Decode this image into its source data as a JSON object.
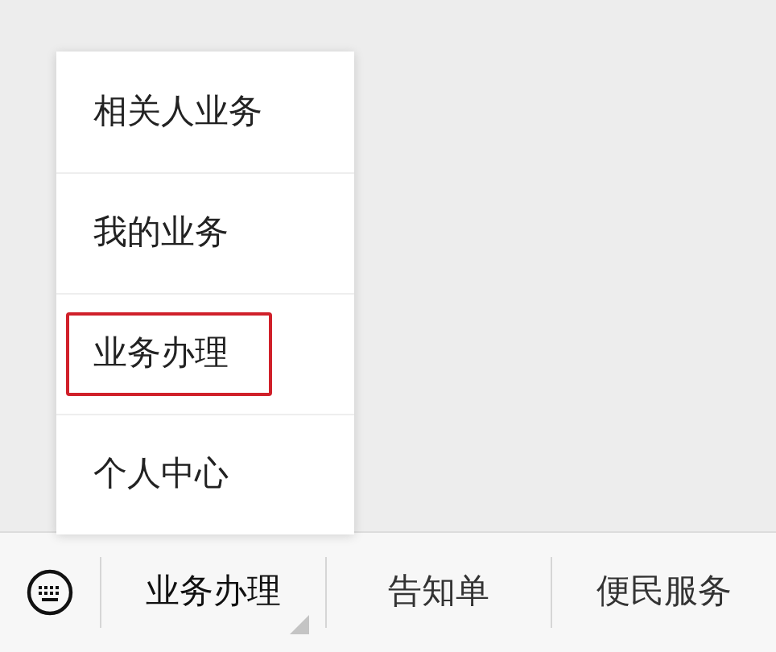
{
  "submenu": {
    "items": [
      {
        "label": "相关人业务",
        "highlighted": false
      },
      {
        "label": "我的业务",
        "highlighted": false
      },
      {
        "label": "业务办理",
        "highlighted": true
      },
      {
        "label": "个人中心",
        "highlighted": false
      }
    ]
  },
  "menu_bar": {
    "items": [
      {
        "label": "业务办理",
        "has_submenu": true,
        "expanded": true
      },
      {
        "label": "告知单",
        "has_submenu": false,
        "expanded": false
      },
      {
        "label": "便民服务",
        "has_submenu": false,
        "expanded": false
      }
    ]
  }
}
